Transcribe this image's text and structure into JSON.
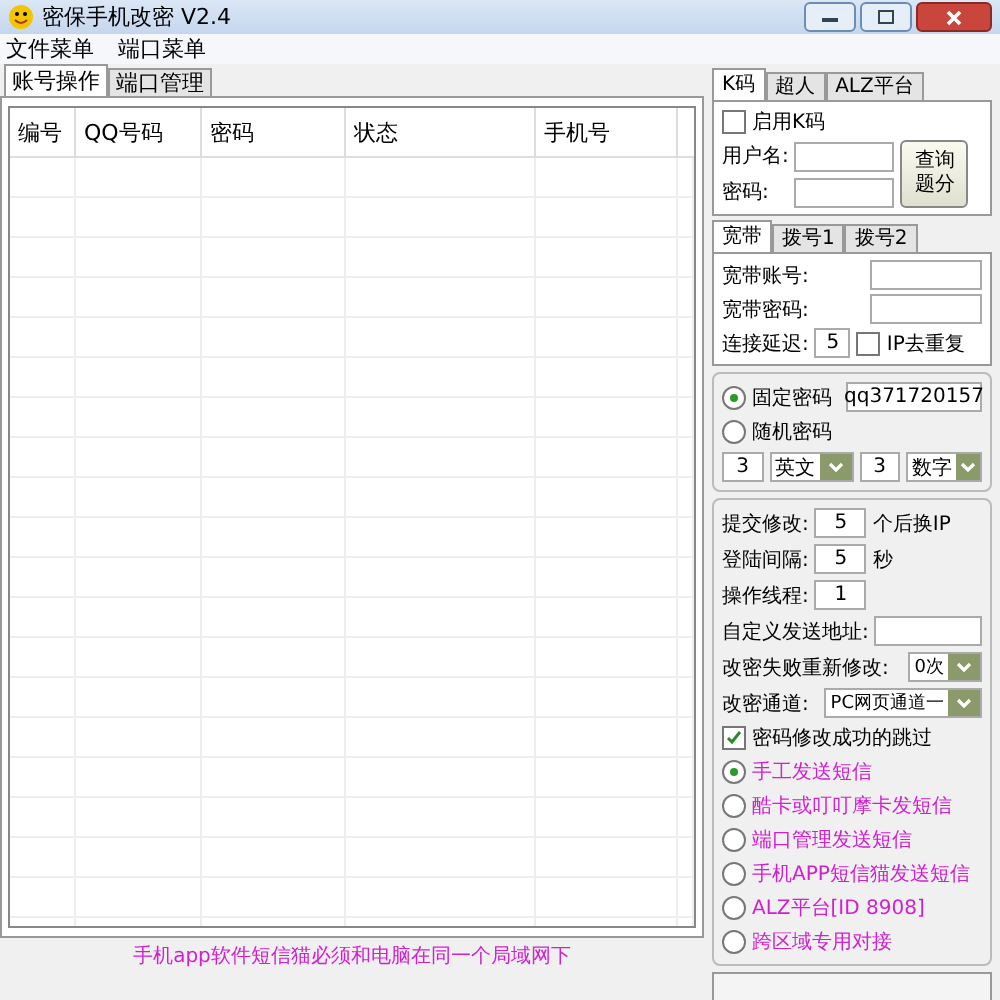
{
  "window": {
    "title": "密保手机改密 V2.4"
  },
  "menu": [
    "文件菜单",
    "端口菜单"
  ],
  "tabs": [
    {
      "label": "账号操作",
      "selected": true
    },
    {
      "label": "端口管理",
      "selected": false
    }
  ],
  "table": {
    "columns": [
      "编号",
      "QQ号码",
      "密码",
      "状态",
      "手机号"
    ]
  },
  "footer_note": "手机app软件短信猫必须和电脑在同一个局域网下",
  "code_tabs": [
    {
      "label": "K码",
      "selected": true
    },
    {
      "label": "超人",
      "selected": false
    },
    {
      "label": "ALZ平台",
      "selected": false
    }
  ],
  "code_panel": {
    "enable": {
      "label": "启用K码",
      "checked": false
    },
    "username_label": "用户名:",
    "password_label": "密码:",
    "query_button": "查询题分"
  },
  "net_tabs": [
    {
      "label": "宽带",
      "selected": true
    },
    {
      "label": "拨号1",
      "selected": false
    },
    {
      "label": "拨号2",
      "selected": false
    }
  ],
  "net_panel": {
    "account_label": "宽带账号:",
    "password_label": "宽带密码:",
    "delay_label": "连接延迟:",
    "delay": "5",
    "dedupe": {
      "label": "IP去重复",
      "checked": false
    }
  },
  "password_mode": [
    {
      "label": "固定密码",
      "selected": true,
      "value": "qq371720157"
    },
    {
      "label": "随机密码",
      "selected": false
    }
  ],
  "random": {
    "count1": "3",
    "type1": "英文",
    "count2": "3",
    "type2": "数字"
  },
  "settings": [
    {
      "kind": "field",
      "label": "提交修改:",
      "value": "5",
      "suffix": "个后换IP"
    },
    {
      "kind": "field",
      "label": "登陆间隔:",
      "value": "5",
      "suffix": "秒"
    },
    {
      "kind": "field",
      "label": "操作线程:",
      "value": "1"
    },
    {
      "kind": "wide",
      "label": "自定义发送地址:"
    },
    {
      "kind": "select",
      "label": "改密失败重新修改:",
      "value": "0次"
    },
    {
      "kind": "select",
      "label": "改密通道:",
      "value": "PC网页通道一"
    },
    {
      "kind": "checkbox",
      "label": "密码修改成功的跳过",
      "checked": true
    }
  ],
  "send_modes": [
    {
      "label": "手工发送短信",
      "selected": true
    },
    {
      "label": "酷卡或叮叮摩卡发短信",
      "selected": false
    },
    {
      "label": "端口管理发送短信",
      "selected": false
    },
    {
      "label": "手机APP短信猫发送短信",
      "selected": false
    },
    {
      "label": "ALZ平台[ID 8908]",
      "selected": false
    },
    {
      "label": "跨区域专用对接",
      "selected": false
    }
  ]
}
